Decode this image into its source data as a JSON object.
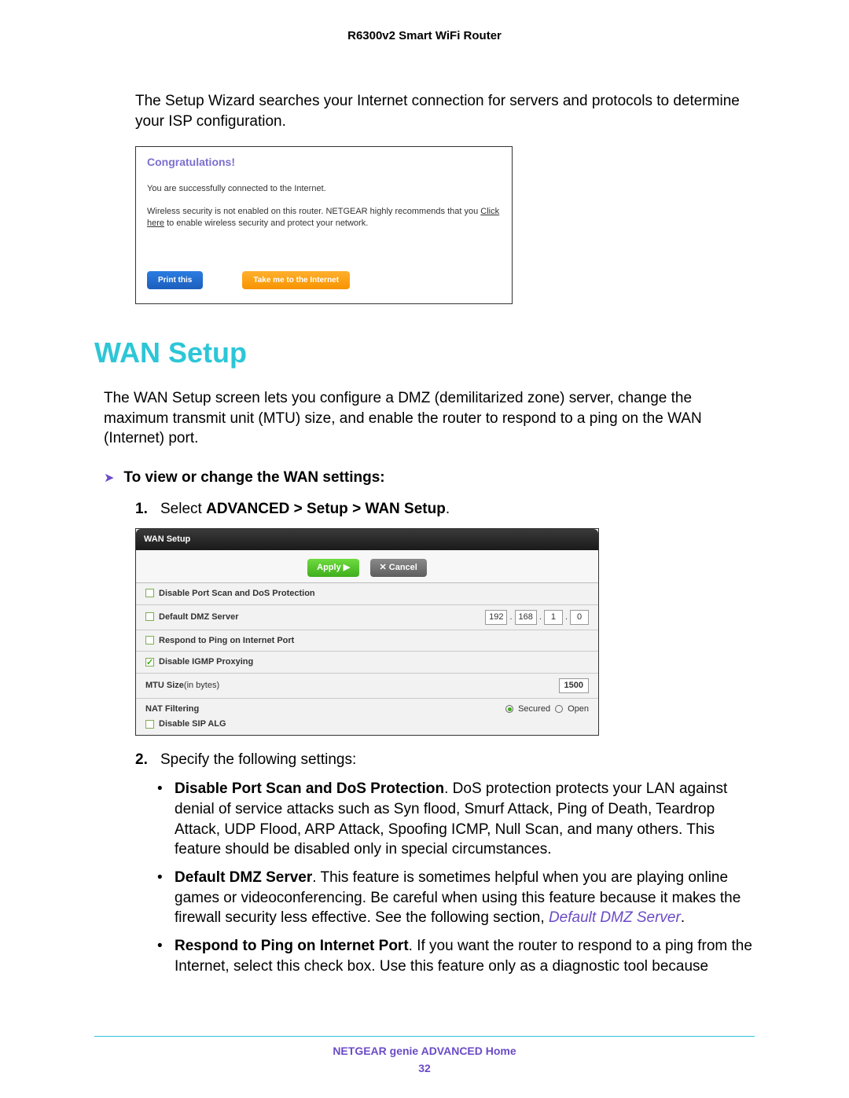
{
  "header": {
    "product": "R6300v2 Smart WiFi Router"
  },
  "intro": "The Setup Wizard searches your Internet connection for servers and protocols to determine your ISP configuration.",
  "congrats": {
    "title": "Congratulations!",
    "line1": "You are successfully connected to the Internet.",
    "line2_pre": "Wireless security is not enabled on this router. NETGEAR highly recommends that you ",
    "line2_link": "Click here",
    "line2_post": " to enable wireless security and protect your network.",
    "btn_print": "Print this",
    "btn_go": "Take me to the Internet"
  },
  "section": {
    "heading": "WAN Setup"
  },
  "wan_intro": "The WAN Setup screen lets you configure a DMZ (demilitarized zone) server, change the maximum transmit unit (MTU) size, and enable the router to respond to a ping on the WAN (Internet) port.",
  "task": "To view or change the WAN settings:",
  "step1": {
    "n": "1.",
    "pre": "Select ",
    "bold": "ADVANCED > Setup > WAN Setup",
    "post": "."
  },
  "wanbox": {
    "title": "WAN Setup",
    "apply": "Apply ▶",
    "cancel": "✕ Cancel",
    "row1": "Disable Port Scan and DoS Protection",
    "row2": "Default DMZ Server",
    "ip": [
      "192",
      "168",
      "1",
      "0"
    ],
    "row3": "Respond to Ping on Internet Port",
    "row4": "Disable IGMP Proxying",
    "row5_label": "MTU Size",
    "row5_unit": "(in bytes)",
    "mtu": "1500",
    "row6_label": "NAT Filtering",
    "row6_sub": "Disable SIP ALG",
    "radio_secured": "Secured",
    "radio_open": "Open"
  },
  "step2": {
    "n": "2.",
    "text": "Specify the following settings:"
  },
  "bullets": {
    "b1_bold": "Disable Port Scan and DoS Protection",
    "b1_text": ". DoS protection protects your LAN against denial of service attacks such as Syn flood, Smurf Attack, Ping of Death, Teardrop Attack, UDP Flood, ARP Attack, Spoofing ICMP, Null Scan, and many others. This feature should be disabled only in special circumstances.",
    "b2_bold": "Default DMZ Server",
    "b2_text": ". This feature is sometimes helpful when you are playing online games or videoconferencing. Be careful when using this feature because it makes the firewall security less effective. See the following section, ",
    "b2_link": "Default DMZ Server",
    "b2_post": ".",
    "b3_bold": "Respond to Ping on Internet Port",
    "b3_text": ". If you want the router to respond to a ping from the Internet, select this check box. Use this feature only as a diagnostic tool because"
  },
  "footer": {
    "title": "NETGEAR genie ADVANCED Home",
    "page": "32"
  }
}
